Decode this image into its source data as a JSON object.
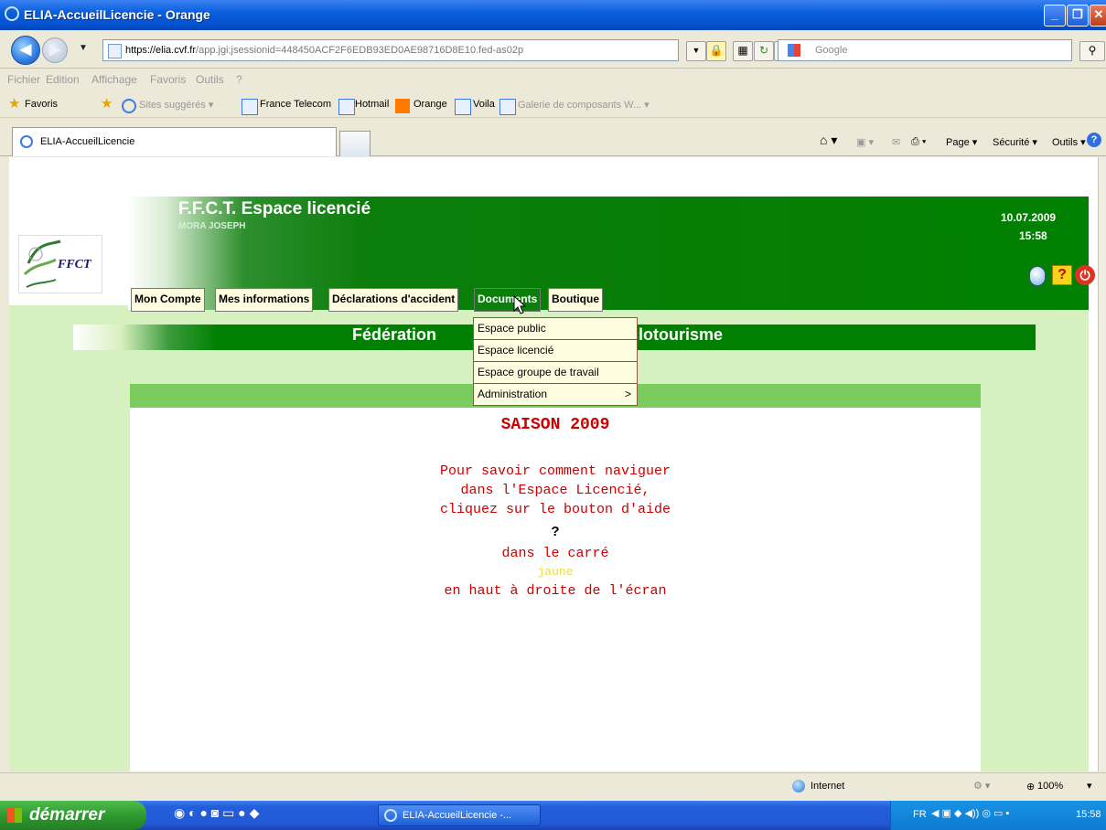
{
  "window": {
    "title": "ELIA-AccueilLicencie - Orange",
    "minimize": "_",
    "restore": "❐",
    "close": "✕"
  },
  "browser": {
    "url_host": "https://elia.cvf.fr",
    "url_rest": "/app.jgi;jsessionid=448450ACF2F6EDB93ED0AE98716D8E10.fed-as02p",
    "search_placeholder": "Google",
    "menu": [
      "Fichier",
      "Edition",
      "Affichage",
      "Favoris",
      "Outils",
      "?"
    ],
    "favorites_label": "Favoris",
    "favorites": [
      "Sites suggérés ▾",
      "France Telecom",
      "Hotmail",
      "Orange",
      "Voila",
      "Galerie de composants W... ▾"
    ],
    "tab_title": "ELIA-AccueilLicencie",
    "commands": [
      "Page ▾",
      "Sécurité ▾",
      "Outils ▾"
    ]
  },
  "site": {
    "title": "F.F.C.T. Espace licencié",
    "user": "MORA JOSEPH",
    "date": "10.07.2009",
    "time": "15:58",
    "logo_text": "FFCT",
    "nav": [
      "Mon Compte",
      "Mes informations",
      "Déclarations d'accident",
      "Documents",
      "Boutique"
    ],
    "active_nav": "Documents",
    "banner_left": "Fédération",
    "banner_right": "clotourisme",
    "dropdown": [
      "Espace public",
      "Espace licencié",
      "Espace groupe de travail",
      "Administration"
    ],
    "dropdown_submenu_arrow": ">",
    "season": "SAISON 2009",
    "help_lines": [
      "Pour savoir comment naviguer",
      "dans l'Espace Licencié,",
      "cliquez sur le bouton d'aide",
      "?",
      "dans le carré",
      "jaune",
      "en haut à droite de l'écran"
    ],
    "help_button": "?"
  },
  "status": {
    "zone": "Internet",
    "zoom": "100%"
  },
  "taskbar": {
    "start": "démarrer",
    "task": "ELIA-AccueilLicencie -...",
    "lang": "FR",
    "clock": "15:58"
  },
  "colors": {
    "site_green": "#008000",
    "light_green": "#d7f0bf",
    "stripe_green": "#7ccb5e",
    "help_red": "#cc0000",
    "help_yellow": "#e8e040"
  }
}
